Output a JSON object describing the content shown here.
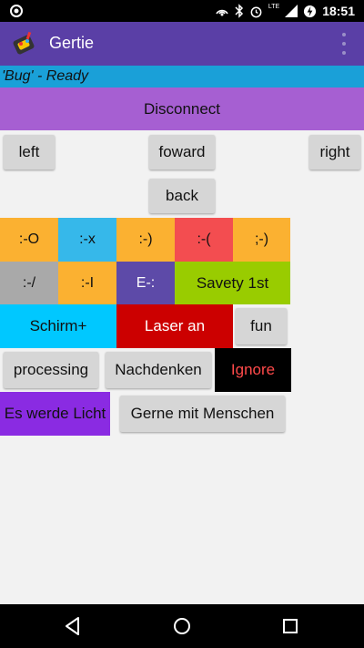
{
  "app": {
    "title": "Gertie"
  },
  "status": {
    "time": "18:51",
    "network": "LTE"
  },
  "bug_status": "'Bug' - Ready",
  "disconnect_label": "Disconnect",
  "drive": {
    "left": "left",
    "forward": "foward",
    "right": "right",
    "back": "back"
  },
  "faces": {
    "row1": [
      {
        "label": ":-O",
        "color": "#fbb131"
      },
      {
        "label": ":-x",
        "color": "#36b8ea"
      },
      {
        "label": ":-)",
        "color": "#fbb131"
      },
      {
        "label": ":-(",
        "color": "#f34d50"
      },
      {
        "label": ";-)",
        "color": "#fbb131"
      }
    ],
    "row2": [
      {
        "label": ":-/",
        "color": "#a9a9a9"
      },
      {
        "label": ":-I",
        "color": "#fbb131"
      },
      {
        "label": "E-:",
        "color": "#5d4aa8"
      },
      {
        "label": "Savety 1st",
        "color": "#99cc00"
      }
    ]
  },
  "actions": {
    "schirm": "Schirm+",
    "laser": "Laser an",
    "fun": "fun",
    "processing": "processing",
    "nachdenken": "Nachdenken",
    "ignore": "Ignore",
    "licht": "Es werde Licht",
    "menschen": "Gerne mit Menschen"
  },
  "colors": {
    "appbar": "#5a3fa6",
    "ready_bar": "#1aa0d8",
    "disconnect": "#a65fd2",
    "schirm": "#00c8ff",
    "laser": "#cc0000",
    "ignore_bg": "#000000",
    "ignore_text": "#ff4a4a",
    "licht": "#8a2be2"
  }
}
